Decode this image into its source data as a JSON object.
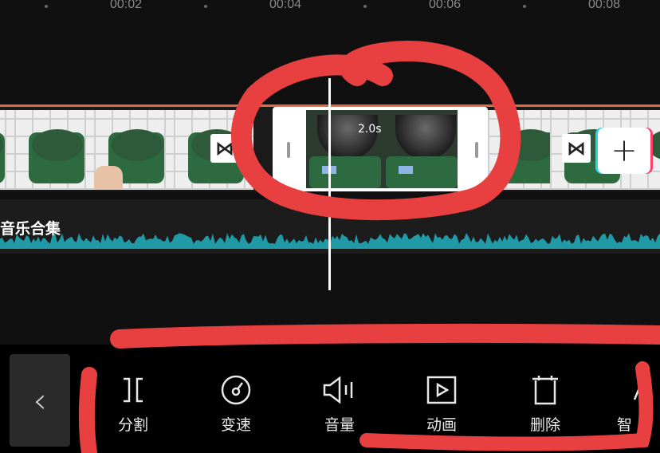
{
  "ruler": {
    "labels": [
      "00:02",
      "00:04",
      "00:06",
      "00:08"
    ]
  },
  "video_track": {
    "selected_clip_duration": "2.0s",
    "transition_icon": "bowtie-icon",
    "add_icon": "plus-icon"
  },
  "audio_track": {
    "label": "音乐合集",
    "wave_color": "#1f9aa6"
  },
  "toolbar": {
    "back_icon": "chevron-left-icon",
    "items": [
      {
        "label": "分割",
        "icon": "split-icon"
      },
      {
        "label": "变速",
        "icon": "speed-icon"
      },
      {
        "label": "音量",
        "icon": "volume-icon"
      },
      {
        "label": "动画",
        "icon": "animation-icon"
      },
      {
        "label": "删除",
        "icon": "delete-icon"
      },
      {
        "label": "智",
        "icon": "smart-icon"
      }
    ]
  },
  "colors": {
    "accent_track_line": "#e46a45",
    "annotation_red": "#e84040"
  }
}
